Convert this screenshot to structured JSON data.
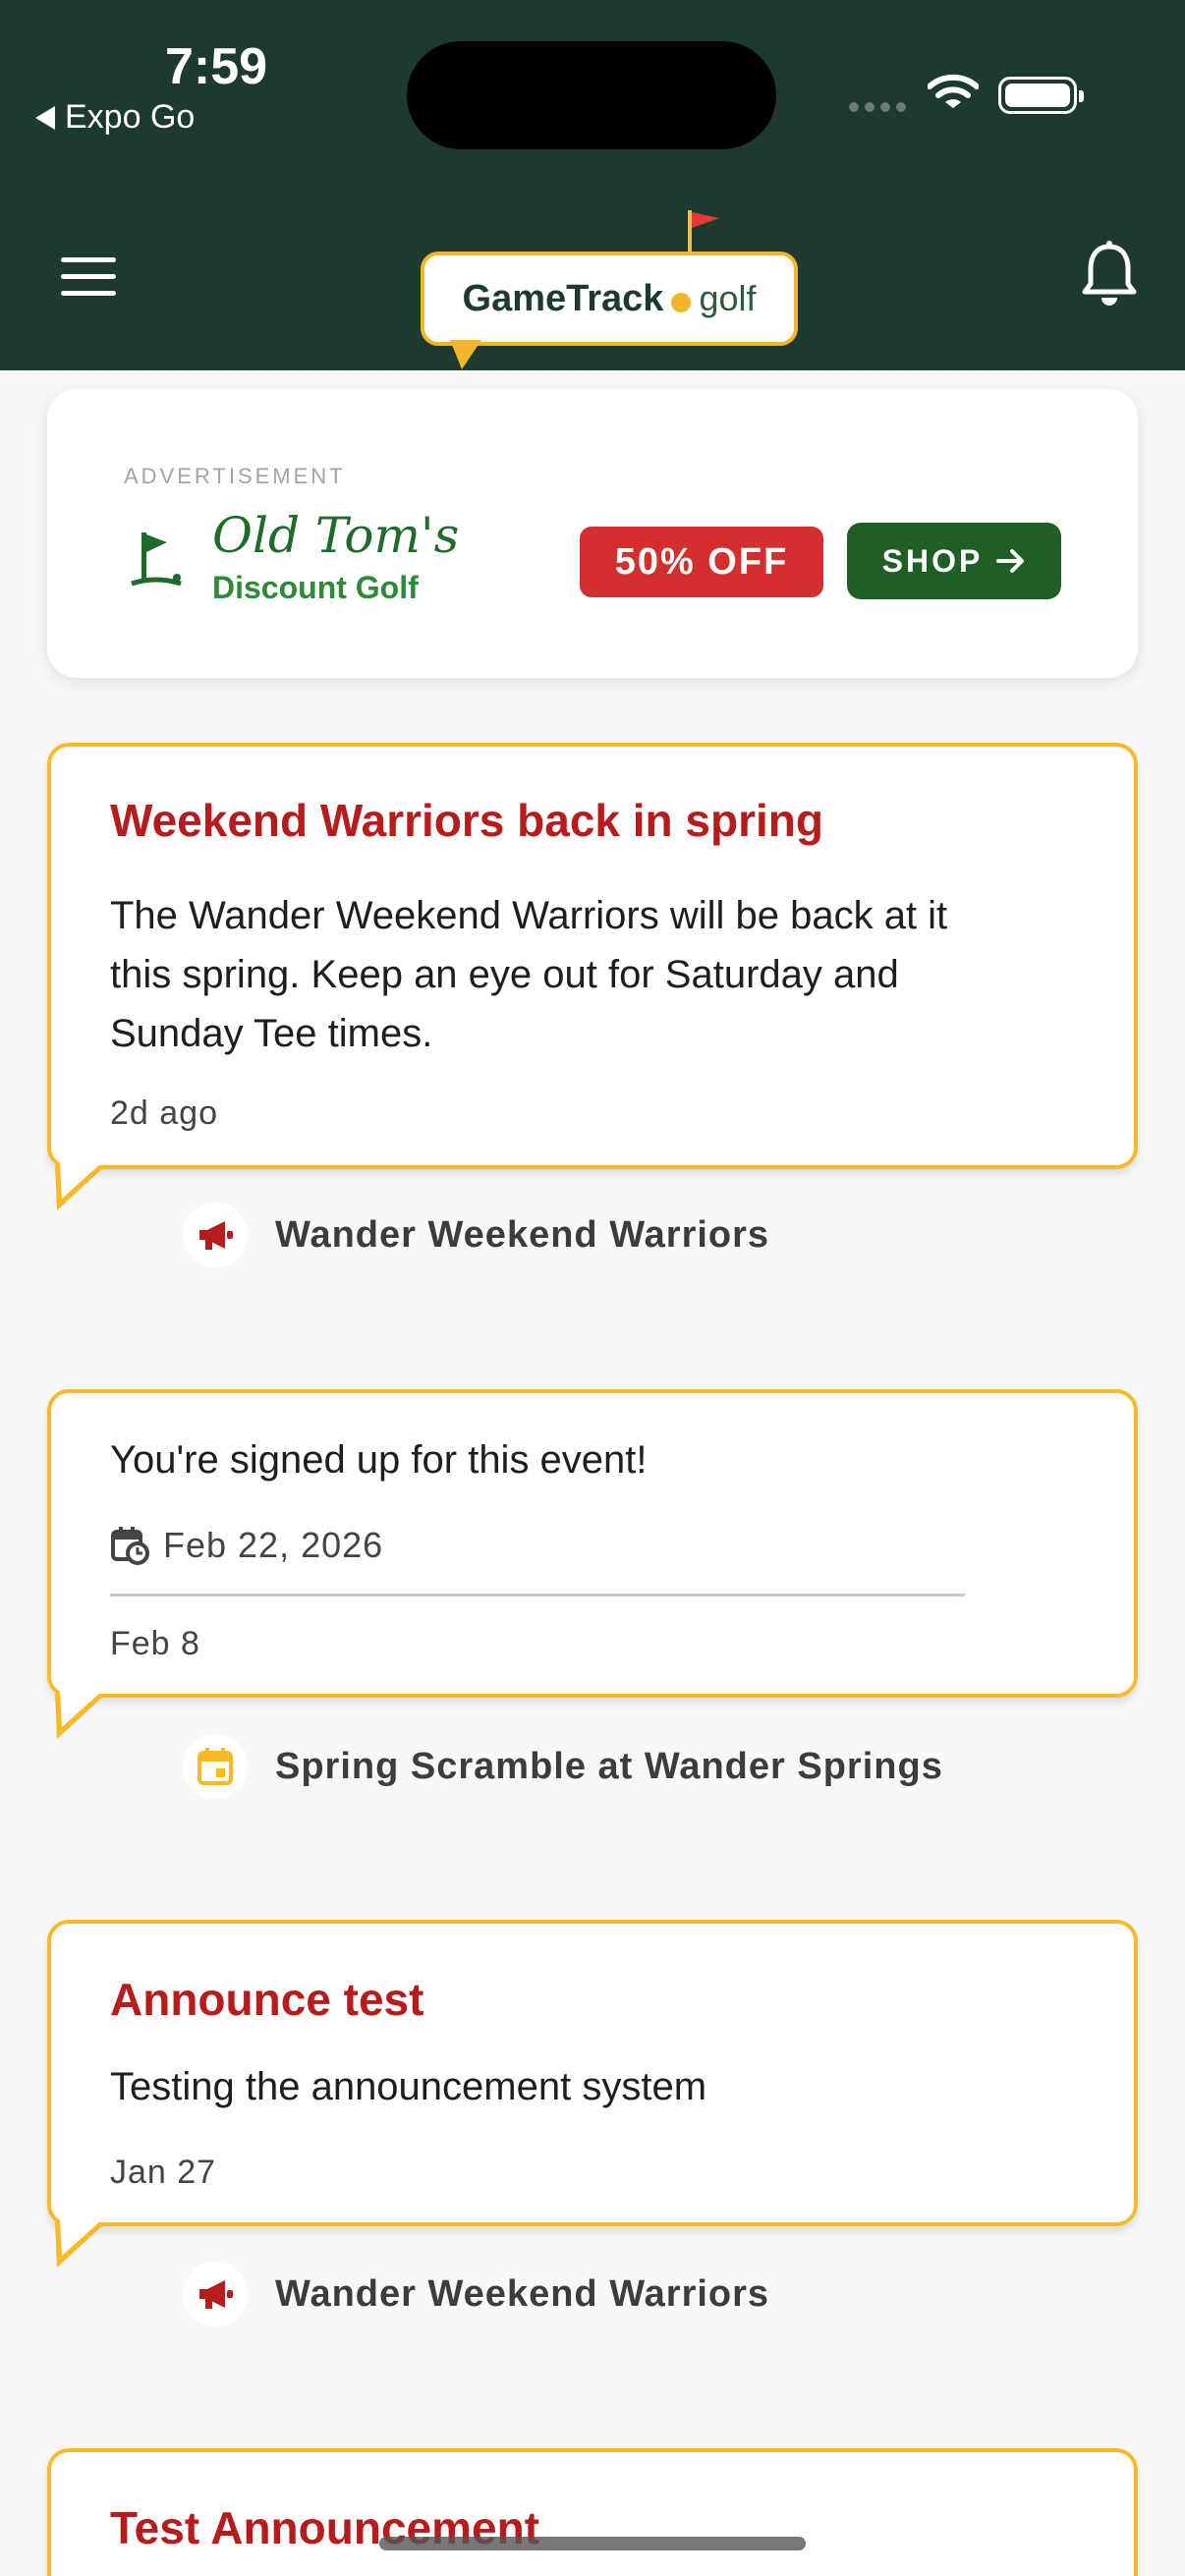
{
  "status_bar": {
    "time": "7:59",
    "back_app": "Expo Go"
  },
  "header": {
    "logo_main": "GameTrack",
    "logo_suffix": "golf"
  },
  "ad": {
    "label": "ADVERTISEMENT",
    "brand_line1": "Old Tom's",
    "brand_line2": "Discount Golf",
    "badge": "50% OFF",
    "shop_label": "SHOP"
  },
  "feed": [
    {
      "type": "announcement",
      "title": "Weekend Warriors back in spring",
      "body": "The Wander Weekend Warriors will be back at it this spring. Keep an eye out for Saturday and Sunday Tee times.",
      "meta": "2d ago",
      "source": "Wander Weekend Warriors"
    },
    {
      "type": "event",
      "body": "You're signed up for this event!",
      "event_date": "Feb 22, 2026",
      "meta": "Feb 8",
      "source": "Spring Scramble at Wander Springs"
    },
    {
      "type": "announcement",
      "title": "Announce test",
      "body": "Testing the announcement system",
      "meta": "Jan 27",
      "source": "Wander Weekend Warriors"
    },
    {
      "type": "announcement",
      "title": "Test Announcement"
    }
  ],
  "colors": {
    "header_bg": "#1c3a2e",
    "card_border": "#f9b928",
    "title_red": "#b71c1c",
    "badge_red": "#d32f2f",
    "shop_green": "#1f5e25"
  }
}
